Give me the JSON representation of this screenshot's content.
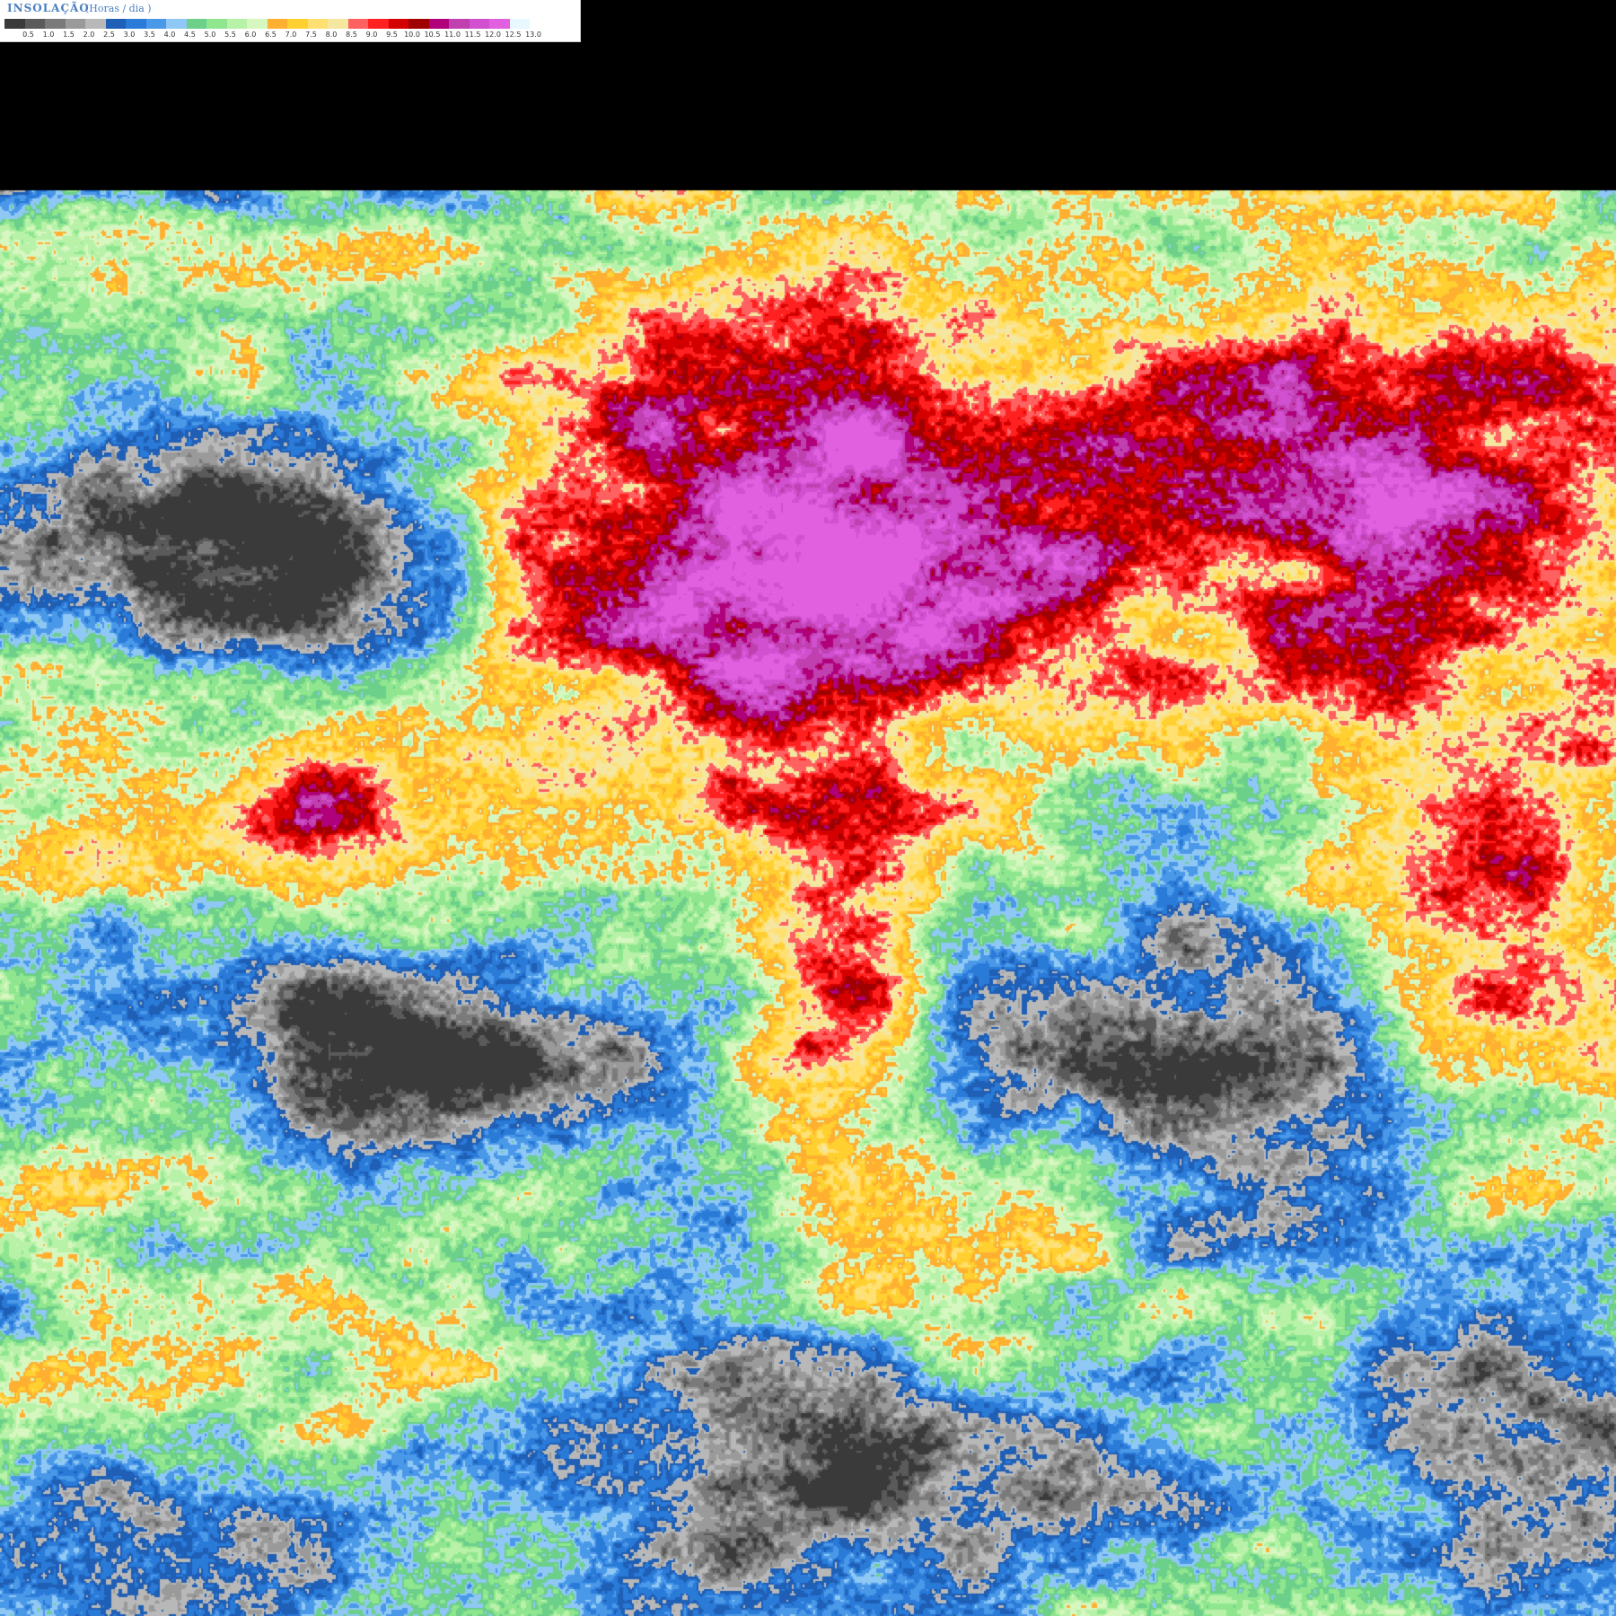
{
  "legend": {
    "title": "INSOLAÇÃO",
    "unit": "(Horas / dia )",
    "colors": [
      "#3a3a3a",
      "#5a5a5a",
      "#7a7a7a",
      "#9a9a9a",
      "#b8b8b8",
      "#1f5fb5",
      "#2a7ad8",
      "#4a98e8",
      "#8fc8f5",
      "#6ccf8a",
      "#8fe68f",
      "#b8f2a8",
      "#d7f7c0",
      "#ffb030",
      "#ffd030",
      "#ffe070",
      "#f5e6a0",
      "#ff6060",
      "#ff2020",
      "#d40000",
      "#a00000",
      "#b0007a",
      "#c040b0",
      "#d050d0",
      "#e060e0",
      "#e8f8ff",
      "#ffffff"
    ],
    "ticks": [
      "0.5",
      "1.0",
      "1.5",
      "2.0",
      "2.5",
      "3.0",
      "3.5",
      "4.0",
      "4.5",
      "5.0",
      "5.5",
      "6.0",
      "6.5",
      "7.0",
      "7.5",
      "8.0",
      "8.5",
      "9.0",
      "9.5",
      "10.0",
      "10.5",
      "11.0",
      "11.5",
      "12.0",
      "12.5",
      "13.0"
    ]
  }
}
